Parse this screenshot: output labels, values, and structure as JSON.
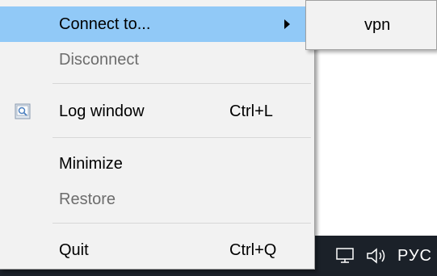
{
  "menu": {
    "items": [
      {
        "label": "Connect to...",
        "shortcut": "",
        "highlighted": true,
        "disabled": false,
        "has_submenu": true
      },
      {
        "label": "Disconnect",
        "shortcut": "",
        "highlighted": false,
        "disabled": true,
        "has_submenu": false
      },
      {
        "label": "Log window",
        "shortcut": "Ctrl+L",
        "icon": "log-window-icon",
        "highlighted": false,
        "disabled": false,
        "has_submenu": false
      },
      {
        "label": "Minimize",
        "shortcut": "",
        "highlighted": false,
        "disabled": false,
        "has_submenu": false
      },
      {
        "label": "Restore",
        "shortcut": "",
        "highlighted": false,
        "disabled": true,
        "has_submenu": false
      },
      {
        "label": "Quit",
        "shortcut": "Ctrl+Q",
        "highlighted": false,
        "disabled": false,
        "has_submenu": false
      }
    ]
  },
  "submenu": {
    "items": [
      {
        "label": "vpn"
      }
    ]
  },
  "taskbar": {
    "icons": [
      "network-icon",
      "speaker-icon"
    ],
    "language": "РУС"
  },
  "colors": {
    "menu_bg": "#f2f2f2",
    "highlight": "#91c9f7",
    "disabled_text": "#6d6d6d",
    "taskbar_bg": "#1b2129"
  }
}
